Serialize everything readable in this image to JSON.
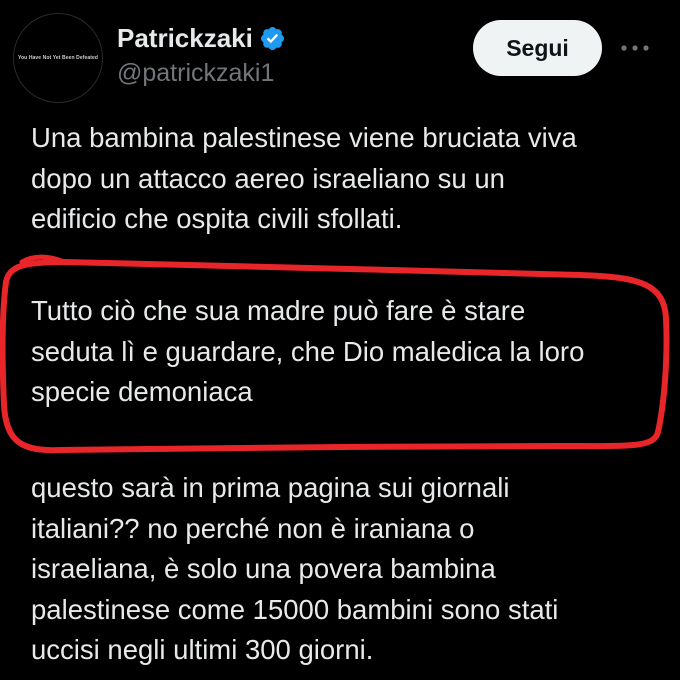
{
  "author": {
    "avatar_text": "You Have Not Yet Been Defeated",
    "display_name": "Patrickzaki",
    "handle": "@patrickzaki1",
    "verified_color": "#1d9bf0"
  },
  "actions": {
    "follow_label": "Segui",
    "more_icon": "more-horizontal-icon"
  },
  "tweet": {
    "paragraph1": [
      "Una bambina palestinese viene bruciata viva",
      "dopo un attacco aereo israeliano su un",
      "edificio che ospita civili sfollati."
    ],
    "paragraph2": [
      "Tutto ciò che sua madre può fare è stare",
      "seduta lì e guardare, che Dio maledica la loro",
      "specie demoniaca"
    ],
    "paragraph3": [
      "questo sarà in prima pagina sui giornali",
      "italiani?? no perché non è iraniana o",
      "israeliana, è solo una povera bambina",
      "palestinese come 15000 bambini sono stati",
      "uccisi negli ultimi 300 giorni."
    ]
  },
  "colors": {
    "background": "#000000",
    "text": "#e7e9ea",
    "secondary_text": "#71767b",
    "button_bg": "#eff3f4",
    "button_text": "#0f1419",
    "annotation_red": "#e8262a"
  }
}
